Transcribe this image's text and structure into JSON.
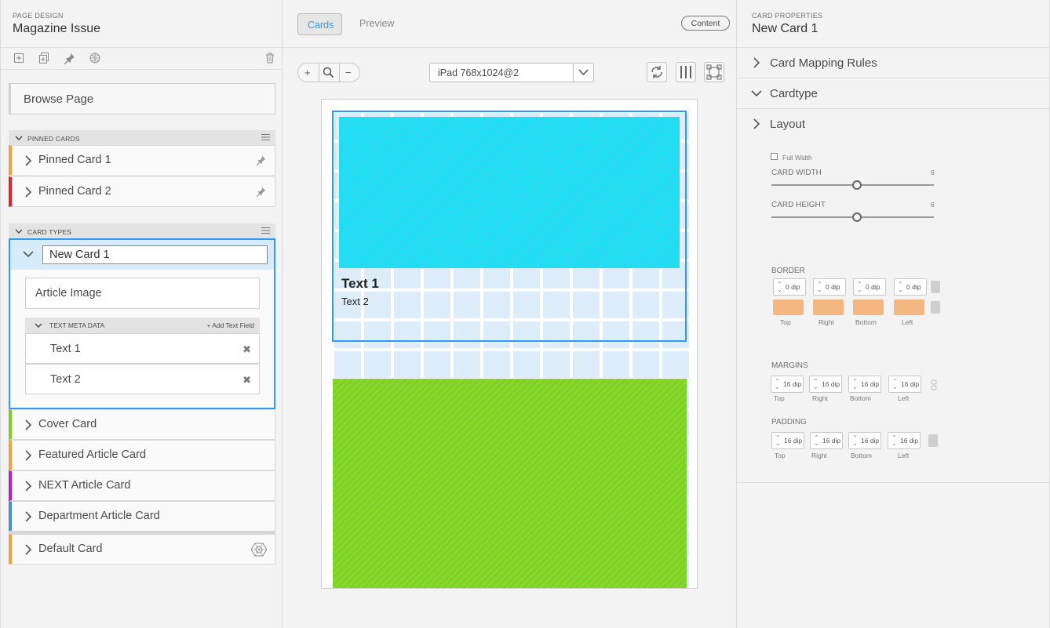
{
  "left": {
    "eyebrow": "PAGE DESIGN",
    "title": "Magazine Issue",
    "browse_label": "Browse Page",
    "pinned": {
      "header": "PINNED CARDS",
      "items": [
        {
          "label": "Pinned Card 1",
          "color": "#f0a23c"
        },
        {
          "label": "Pinned Card 2",
          "color": "#e2202e"
        }
      ]
    },
    "card_types": {
      "header": "CARD TYPES",
      "new_card_value": "New Card 1",
      "article_image": "Article Image",
      "text_meta_header": "TEXT META DATA",
      "add_text_field": "+ Add Text Field",
      "text_fields": [
        "Text 1",
        "Text 2"
      ],
      "items": [
        {
          "label": "Cover Card",
          "color": "#7ccc2a"
        },
        {
          "label": "Featured Article Card",
          "color": "#f0a23c"
        },
        {
          "label": "NEXT Article Card",
          "color": "#b21fc9"
        },
        {
          "label": "Department Article Card",
          "color": "#4a8fd6"
        }
      ],
      "default_card": {
        "label": "Default Card",
        "color": "#f0a23c"
      }
    }
  },
  "center": {
    "tabs": {
      "cards": "Cards",
      "preview": "Preview"
    },
    "content_button": "Content",
    "zoom": {
      "in": "+",
      "out": "−"
    },
    "device": "iPad 768x1024@2",
    "preview": {
      "text1": "Text 1",
      "text2": "Text 2",
      "card1_color": "#1ae1f4",
      "card2_color": "#7ed321"
    }
  },
  "right": {
    "eyebrow": "CARD PROPERTIES",
    "title": "New Card 1",
    "sections": [
      "Card Mapping Rules",
      "Cardtype",
      "Layout"
    ],
    "layout": {
      "full_width": "Full Width",
      "card_width_label": "CARD WIDTH",
      "card_width_value": "6",
      "card_height_label": "CARD HEIGHT",
      "card_height_value": "6",
      "border_label": "BORDER",
      "border_values": [
        "0 dip",
        "0 dip",
        "0 dip",
        "0 dip"
      ],
      "border_color": "#f5b782",
      "sides": [
        "Top",
        "Right",
        "Bottom",
        "Left"
      ],
      "margins_label": "MARGINS",
      "margin_values": [
        "16 dip",
        "16 dip",
        "16 dip",
        "16 dip"
      ],
      "padding_label": "PADDING",
      "padding_values": [
        "16 dip",
        "16 dip",
        "16 dip",
        "16 dip"
      ]
    }
  }
}
